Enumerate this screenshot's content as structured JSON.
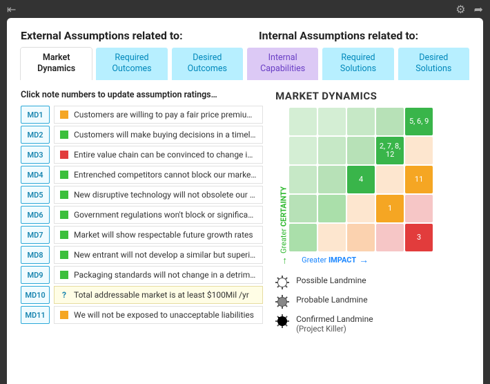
{
  "topbar": {
    "back": "⇤",
    "settings": "⚙",
    "forward": "➦"
  },
  "headers": {
    "external": "External Assumptions related to:",
    "internal": "Internal Assumptions related to:"
  },
  "tabs": [
    {
      "l1": "Market",
      "l2": "Dynamics",
      "style": "active"
    },
    {
      "l1": "Required",
      "l2": "Outcomes",
      "style": "cyan"
    },
    {
      "l1": "Desired",
      "l2": "Outcomes",
      "style": "cyan"
    },
    {
      "l1": "Internal",
      "l2": "Capabilities",
      "style": "purple"
    },
    {
      "l1": "Required",
      "l2": "Solutions",
      "style": "cyan"
    },
    {
      "l1": "Desired",
      "l2": "Solutions",
      "style": "cyan"
    }
  ],
  "hint": "Click note numbers to update assumption ratings…",
  "rows": [
    {
      "id": "MD1",
      "rating": "orange",
      "text": "Customers are willing to pay a fair price premium for val…"
    },
    {
      "id": "MD2",
      "rating": "green",
      "text": "Customers will make buying decisions in a timely fashion"
    },
    {
      "id": "MD3",
      "rating": "red",
      "text": "Entire value chain can be convinced to change in sync"
    },
    {
      "id": "MD4",
      "rating": "green",
      "text": "Entrenched competitors cannot block our market entry"
    },
    {
      "id": "MD5",
      "rating": "green",
      "text": "New disruptive technology will not obsolete our offering"
    },
    {
      "id": "MD6",
      "rating": "green",
      "text": "Government regulations won't block or significantly dela…"
    },
    {
      "id": "MD7",
      "rating": "green",
      "text": "Market will show respectable future growth rates"
    },
    {
      "id": "MD8",
      "rating": "green",
      "text": "New entrant will not develop a similar but superior offer…"
    },
    {
      "id": "MD9",
      "rating": "green",
      "text": "Packaging standards will not change in a detrimental fas…"
    },
    {
      "id": "MD10",
      "rating": "q",
      "text": "Total addressable market is at least $100Mil /yr",
      "hl": true
    },
    {
      "id": "MD11",
      "rating": "orange",
      "text": "We will not be exposed to unacceptable liabilities"
    }
  ],
  "matrix": {
    "title": "MARKET DYNAMICS",
    "ylabel_a": "Greater",
    "ylabel_b": "CERTAINTY",
    "xlabel_a": "Greater",
    "xlabel_b": "IMPACT",
    "cells": [
      [
        "#d4eed4",
        "#d4eed4",
        "#c6e8c6",
        "#b7e1b7",
        "#39b54a:5, 6, 9"
      ],
      [
        "#d4eed4",
        "#c6e8c6",
        "#b7e1b7",
        "#39b54a:2, 7, 8, 12",
        "#fde6cf"
      ],
      [
        "#c6e8c6",
        "#b7e1b7",
        "#39b54a:4",
        "#fde6cf",
        "#f5a623:11"
      ],
      [
        "#b7e1b7",
        "#aadfaa",
        "#fde6cf",
        "#f5a623:1",
        "#f6c6c6"
      ],
      [
        "#aadfaa",
        "#fde6cf",
        "#fbd2af",
        "#f6c6c6",
        "#e23c3c:3"
      ]
    ]
  },
  "legend": {
    "possible": "Possible Landmine",
    "probable": "Probable Landmine",
    "confirmed": "Confirmed Landmine",
    "confirmed_sub": "(Project Killer)"
  }
}
